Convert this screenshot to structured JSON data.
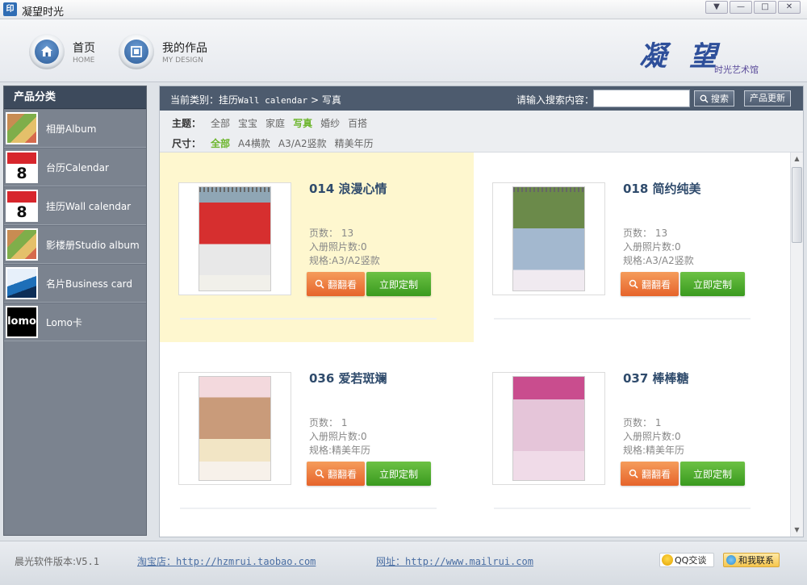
{
  "window": {
    "icon_text": "印",
    "title": "凝望时光",
    "controls": [
      "▼",
      "—",
      "□",
      "✕"
    ]
  },
  "header": {
    "nav": [
      {
        "cn": "首页",
        "en": "HOME"
      },
      {
        "cn": "我的作品",
        "en": "MY DESIGN"
      }
    ],
    "logo_main": "凝望",
    "logo_sub": "时光艺术馆"
  },
  "sidebar": {
    "heading": "产品分类",
    "items": [
      {
        "label": "相册Album"
      },
      {
        "label": "台历Calendar"
      },
      {
        "label": "挂历Wall calendar"
      },
      {
        "label": "影楼册Studio album"
      },
      {
        "label": "名片Business card"
      },
      {
        "label": "Lomo卡",
        "thumb_text": "lomo"
      }
    ]
  },
  "topbar": {
    "crumb_prefix": "当前类别：",
    "crumb_cn": "挂历",
    "crumb_en": "Wall calendar",
    "crumb_sep": ">",
    "crumb_current": "写真",
    "search_label": "请输入搜索内容：",
    "search_value": "",
    "search_button": "搜索",
    "update_button": "产品更新"
  },
  "filters": {
    "theme_label": "主题：",
    "theme_options": [
      "全部",
      "宝宝",
      "家庭",
      "写真",
      "婚纱",
      "百搭"
    ],
    "theme_active": "写真",
    "size_label": "尺寸：",
    "size_options": [
      "全部",
      "A4横款",
      "A3/A2竖款",
      "精美年历"
    ],
    "size_active": "全部"
  },
  "products": [
    {
      "title": "014 浪漫心情",
      "pages": "页数： 13",
      "photos": "入册照片数:0",
      "spec": "规格:A3/A2竖款",
      "highlight": true
    },
    {
      "title": "018 简约纯美",
      "pages": "页数： 13",
      "photos": "入册照片数:0",
      "spec": "规格:A3/A2竖款",
      "highlight": false
    },
    {
      "title": "036 爱若斑斓",
      "pages": "页数： 1",
      "photos": "入册照片数:0",
      "spec": "规格:精美年历",
      "highlight": false
    },
    {
      "title": "037 棒棒糖",
      "pages": "页数： 1",
      "photos": "入册照片数:0",
      "spec": "规格:精美年历",
      "highlight": false
    }
  ],
  "card_buttons": {
    "flip": "翻翻看",
    "custom": "立即定制"
  },
  "footer": {
    "version_prefix": "晨光软件版本:",
    "version": "V5.1",
    "shop_prefix": "淘宝店：",
    "shop_url": "http://hzmrui.taobao.com",
    "site_prefix": "网址：",
    "site_url": "http://www.mailrui.com",
    "qq_label": "QQ交谈",
    "contact_label": "和我联系"
  },
  "colors": {
    "accent_green": "#6bb52b",
    "flip_orange": "#e6642b",
    "custom_green": "#3a9a1f",
    "highlight_yellow": "#fef7cf",
    "topbar": "#4d5b6e"
  }
}
